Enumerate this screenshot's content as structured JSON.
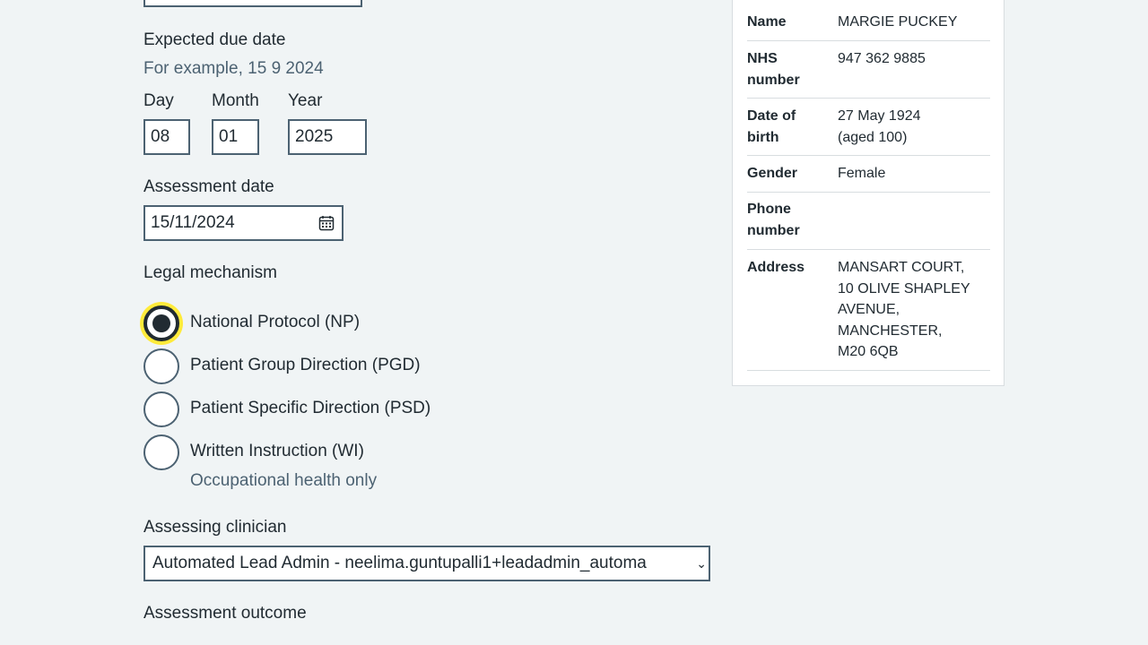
{
  "form": {
    "due_date": {
      "label": "Expected due date",
      "hint": "For example, 15 9 2024",
      "day_label": "Day",
      "month_label": "Month",
      "year_label": "Year",
      "day_value": "08",
      "month_value": "01",
      "year_value": "2025"
    },
    "assessment_date": {
      "label": "Assessment date",
      "value": "15/11/2024",
      "icon": "calendar-icon"
    },
    "legal_mechanism": {
      "label": "Legal mechanism",
      "options": [
        {
          "label": "National Protocol (NP)",
          "checked": true
        },
        {
          "label": "Patient Group Direction (PGD)",
          "checked": false
        },
        {
          "label": "Patient Specific Direction (PSD)",
          "checked": false
        },
        {
          "label": "Written Instruction (WI)",
          "checked": false,
          "hint": "Occupational health only"
        }
      ]
    },
    "clinician": {
      "label": "Assessing clinician",
      "selected": "Automated Lead Admin - neelima.guntupalli1+leadadmin_automa"
    },
    "outcome": {
      "label": "Assessment outcome"
    }
  },
  "patient": {
    "rows": [
      {
        "key": "Name",
        "value": "MARGIE PUCKEY"
      },
      {
        "key": "NHS number",
        "value": "947 362 9885"
      },
      {
        "key": "Date of birth",
        "value": "27 May 1924 (aged 100)"
      },
      {
        "key": "Gender",
        "value": "Female"
      },
      {
        "key": "Phone number",
        "value": ""
      },
      {
        "key": "Address",
        "value": "MANSART COURT, 10 OLIVE SHAPLEY AVENUE, MANCHESTER, M20 6QB"
      }
    ]
  },
  "colors": {
    "background": "#f0f4f5",
    "text": "#212b32",
    "secondary_text": "#4c6272",
    "focus": "#ffeb3b"
  }
}
